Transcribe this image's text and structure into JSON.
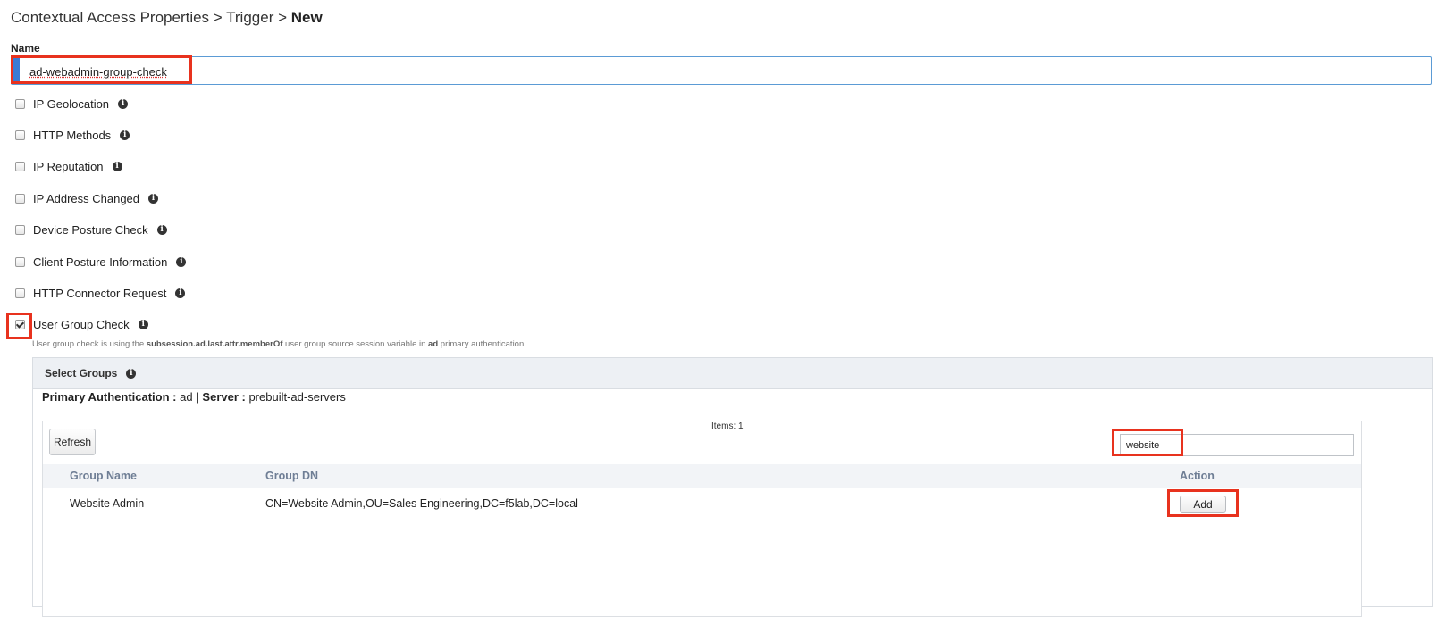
{
  "breadcrumb": {
    "part1": "Contextual Access Properties",
    "sep1": " > ",
    "part2": "Trigger",
    "sep2": " > ",
    "current": "New"
  },
  "name_field": {
    "label": "Name",
    "value": "ad-webadmin-group-check"
  },
  "conditions": [
    {
      "label": "IP Geolocation",
      "checked": false
    },
    {
      "label": "HTTP Methods",
      "checked": false
    },
    {
      "label": "IP Reputation",
      "checked": false
    },
    {
      "label": "IP Address Changed",
      "checked": false
    },
    {
      "label": "Device Posture Check",
      "checked": false
    },
    {
      "label": "Client Posture Information",
      "checked": false
    },
    {
      "label": "HTTP Connector Request",
      "checked": false
    },
    {
      "label": "User Group Check",
      "checked": true
    }
  ],
  "hint": {
    "pre": "User group check is using the ",
    "variable": "subsession.ad.last.attr.memberOf",
    "mid": " user group source session variable in ",
    "auth": "ad",
    "post": " primary authentication."
  },
  "groups_panel": {
    "title": "Select Groups",
    "auth_label": "Primary Authentication :",
    "auth_value": " ad ",
    "server_label": "| Server :",
    "server_value": " prebuilt-ad-servers",
    "refresh_label": "Refresh",
    "items_count": "Items: 1",
    "search_value": "website",
    "columns": [
      "Group Name",
      "Group DN",
      "Action"
    ],
    "rows": [
      {
        "name": "Website Admin",
        "dn": "CN=Website Admin,OU=Sales Engineering,DC=f5lab,DC=local",
        "action": "Add"
      }
    ]
  },
  "info_icon_glyph": "i",
  "highlight_color": "#e8321e",
  "accent_color": "#3a7bd5"
}
